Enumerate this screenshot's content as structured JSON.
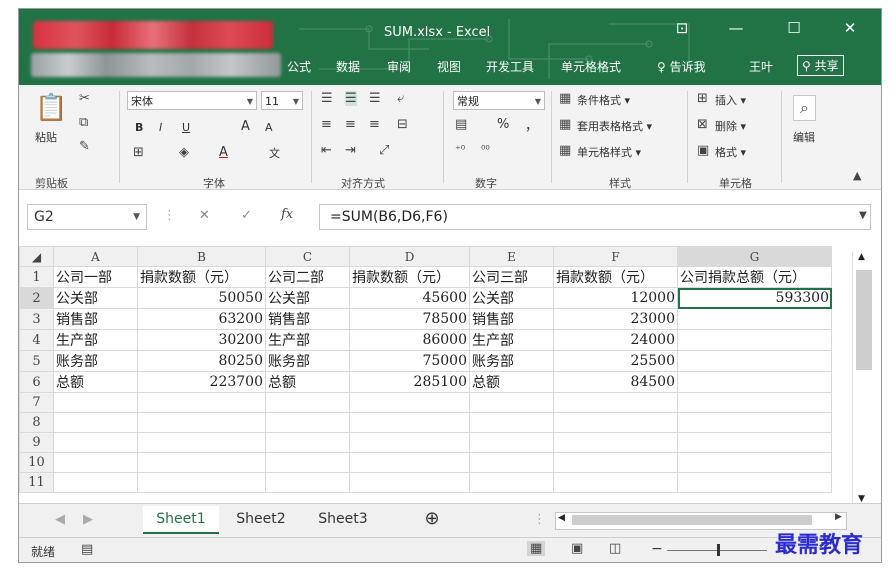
{
  "title_bar": {
    "doc_title": "SUM.xlsx - Excel",
    "ctrl_icons": [
      "restore-ribbon-icon",
      "minimize-icon",
      "maximize-icon",
      "close-icon"
    ],
    "ctrl_glyphs": [
      "⊡",
      "—",
      "☐",
      "✕"
    ]
  },
  "menu": {
    "tabs": [
      "公式",
      "数据",
      "审阅",
      "视图",
      "开发工具",
      "单元格格式"
    ],
    "tell_me": "告诉我",
    "user": "王叶",
    "share": "共享"
  },
  "ribbon": {
    "clipboard": {
      "paste": "粘贴",
      "label": "剪贴板"
    },
    "font": {
      "name": "宋体",
      "size": "11",
      "label": "字体",
      "bold": "B",
      "italic": "I",
      "underline": "U",
      "grow": "A",
      "shrink": "A",
      "color_a": "A",
      "wen": "文"
    },
    "alignment": {
      "label": "对齐方式"
    },
    "number": {
      "format": "常规",
      "percent": "%",
      "comma": "，",
      "label": "数字"
    },
    "styles": {
      "cond": "条件格式 ▾",
      "table": "套用表格格式 ▾",
      "cell": "单元格样式 ▾",
      "label": "样式"
    },
    "cells": {
      "insert": "插入 ▾",
      "delete": "删除 ▾",
      "format": "格式 ▾",
      "label": "单元格"
    },
    "editing": {
      "label": "编辑"
    }
  },
  "formula_bar": {
    "name_box": "G2",
    "formula": "=SUM(B6,D6,F6)",
    "fx": "fx",
    "cancel": "✕",
    "confirm": "✓"
  },
  "sheet": {
    "columns": [
      "A",
      "B",
      "C",
      "D",
      "E",
      "F",
      "G"
    ],
    "rows": [
      [
        "公司一部",
        "捐款数额（元）",
        "公司二部",
        "捐款数额（元）",
        "公司三部",
        "捐款数额（元）",
        "公司捐款总额（元）"
      ],
      [
        "公关部",
        "50050",
        "公关部",
        "45600",
        "公关部",
        "12000",
        "593300"
      ],
      [
        "销售部",
        "63200",
        "销售部",
        "78500",
        "销售部",
        "23000",
        ""
      ],
      [
        "生产部",
        "30200",
        "生产部",
        "86000",
        "生产部",
        "24000",
        ""
      ],
      [
        "账务部",
        "80250",
        "账务部",
        "75000",
        "账务部",
        "25500",
        ""
      ],
      [
        "总额",
        "223700",
        "总额",
        "285100",
        "总额",
        "84500",
        ""
      ],
      [
        "",
        "",
        "",
        "",
        "",
        "",
        ""
      ],
      [
        "",
        "",
        "",
        "",
        "",
        "",
        ""
      ],
      [
        "",
        "",
        "",
        "",
        "",
        "",
        ""
      ],
      [
        "",
        "",
        "",
        "",
        "",
        "",
        ""
      ],
      [
        "",
        "",
        "",
        "",
        "",
        "",
        ""
      ]
    ],
    "row_numbers": [
      "1",
      "2",
      "3",
      "4",
      "5",
      "6",
      "7",
      "8",
      "9",
      "10",
      "11"
    ]
  },
  "tabs": {
    "sheets": [
      "Sheet1",
      "Sheet2",
      "Sheet3"
    ],
    "add": "⊕"
  },
  "status": {
    "ready": "就绪"
  },
  "watermark": "最需教育",
  "colors": {
    "excel_green": "#217346",
    "select_blue": "#2b2bd6"
  }
}
